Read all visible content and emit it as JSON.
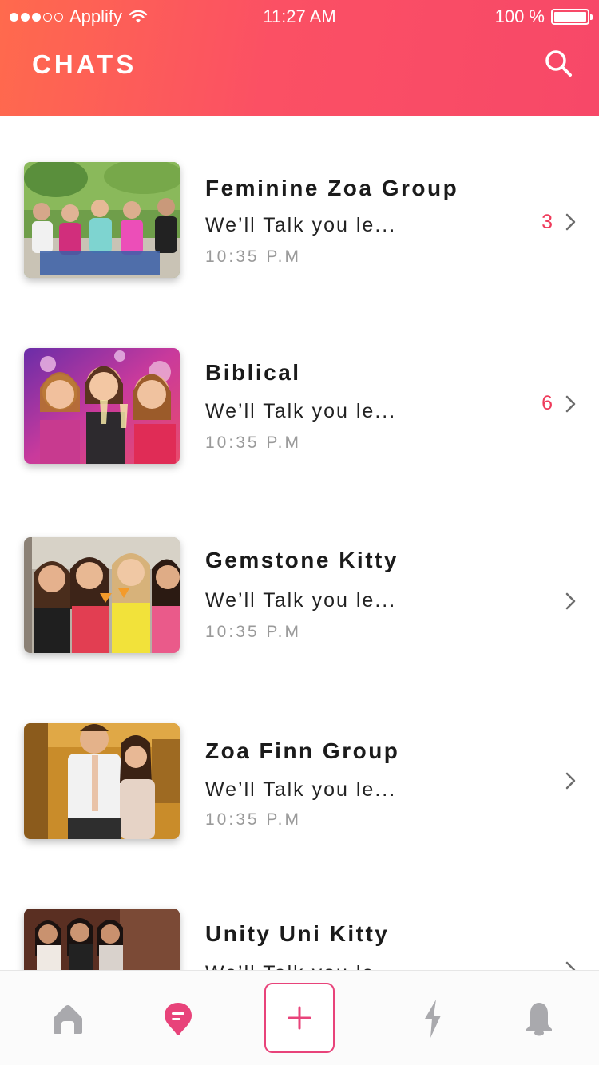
{
  "status_bar": {
    "carrier": "Applify",
    "time": "11:27 AM",
    "battery": "100 %"
  },
  "header": {
    "title": "CHATS",
    "search_icon": "search-icon"
  },
  "chats": [
    {
      "name": "Feminine Zoa Group",
      "preview": "We’ll Talk you le...",
      "time": "10:35 P.M",
      "unread": "3"
    },
    {
      "name": "Biblical",
      "preview": "We’ll Talk you le...",
      "time": "10:35 P.M",
      "unread": "6"
    },
    {
      "name": "Gemstone Kitty",
      "preview": "We’ll Talk you le...",
      "time": "10:35 P.M",
      "unread": ""
    },
    {
      "name": "Zoa Finn Group",
      "preview": "We’ll Talk you le...",
      "time": "10:35 P.M",
      "unread": ""
    },
    {
      "name": "Unity Uni Kitty",
      "preview": "We’ll Talk you le...",
      "time": "",
      "unread": ""
    }
  ],
  "tabbar": {
    "tabs": [
      "home-icon",
      "chat-icon",
      "plus-icon",
      "bolt-icon",
      "bell-icon"
    ],
    "active": "chat-icon"
  },
  "colors": {
    "header_start": "#ff6a4d",
    "header_end": "#f74868",
    "accent": "#ef3b5b",
    "tab_active": "#e8437a",
    "tab_inactive": "#a9a9ad"
  }
}
